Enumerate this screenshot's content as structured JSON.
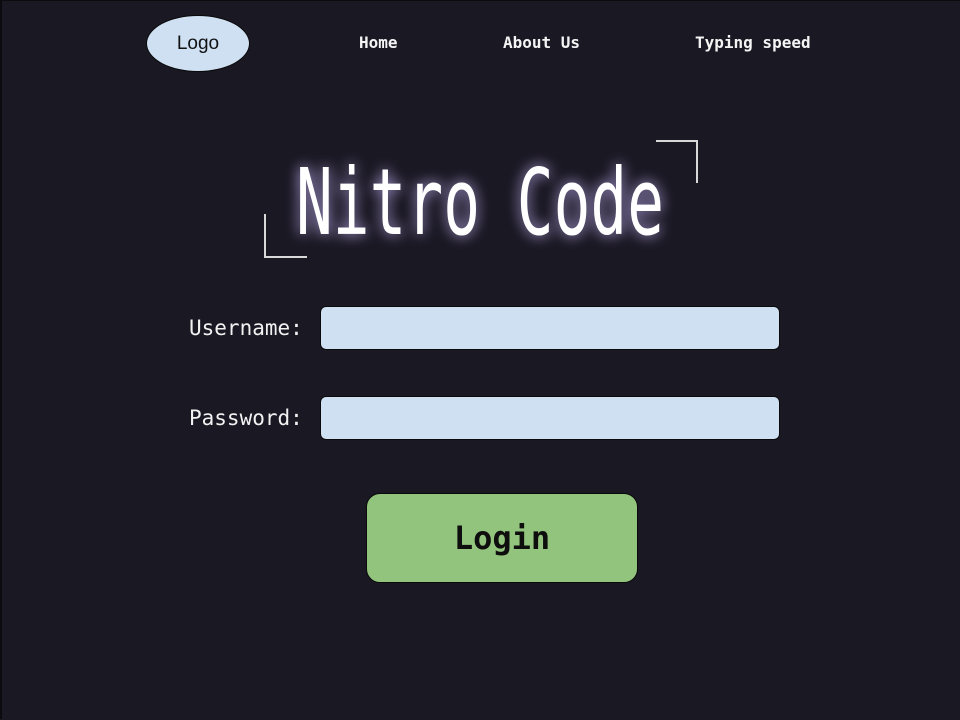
{
  "nav": {
    "logo": "Logo",
    "home": "Home",
    "about": "About Us",
    "typing": "Typing speed"
  },
  "hero": {
    "title": "Nitro Code"
  },
  "form": {
    "username_label": "Username:",
    "username_value": "",
    "password_label": "Password:",
    "password_value": "",
    "login_label": "Login"
  },
  "colors": {
    "background": "#1a1823",
    "input_fill": "#cfe0f3",
    "login_button": "#93c47d",
    "title_glow": "#b9a8e6"
  }
}
